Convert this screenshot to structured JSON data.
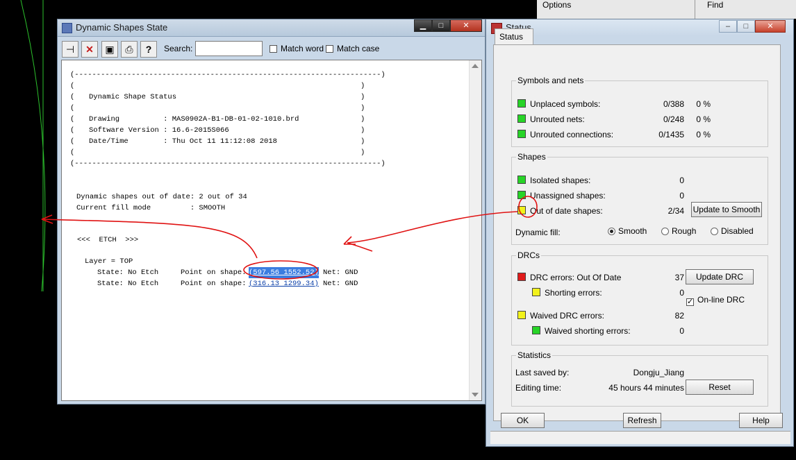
{
  "background": {
    "options_label": "Options",
    "find_label": "Find"
  },
  "dynamic_window": {
    "title": "Dynamic Shapes State",
    "search_label": "Search:",
    "search_value": "",
    "match_word": "Match word",
    "match_case": "Match case",
    "report": {
      "border": "(----------------------------------------------------------------------)",
      "paren_left": "(",
      "paren_right": ")",
      "heading": "Dynamic Shape Status",
      "drawing_line": "Drawing          : MAS0902A-B1-DB-01-02-1010.brd",
      "software_line": "Software Version : 16.6-2015S066",
      "date_line": "Date/Time        : Thu Oct 11 11:12:08 2018",
      "out_of_date_line": "Dynamic shapes out of date: 2 out of 34",
      "fill_mode_line": "Current fill mode         : SMOOTH",
      "etch_line": "<<<  ETCH  >>>",
      "layer_line": "Layer = TOP",
      "rows": [
        {
          "state": "State: No Etch",
          "point_label": "Point on shape:",
          "point": "(597.56 1552.52)",
          "net": "Net: GND"
        },
        {
          "state": "State: No Etch",
          "point_label": "Point on shape:",
          "point": "(316.13 1299.34)",
          "net": "Net: GND"
        }
      ]
    }
  },
  "status_window": {
    "title": "Status",
    "tab": "Status",
    "symbols": {
      "label": "Symbols and nets",
      "rows": [
        {
          "label": "Unplaced symbols:",
          "value": "0/388",
          "pct": "0 %",
          "color": "#27d427"
        },
        {
          "label": "Unrouted nets:",
          "value": "0/248",
          "pct": "0 %",
          "color": "#27d427"
        },
        {
          "label": "Unrouted connections:",
          "value": "0/1435",
          "pct": "0 %",
          "color": "#27d427"
        }
      ]
    },
    "shapes": {
      "label": "Shapes",
      "isolated": {
        "label": "Isolated shapes:",
        "value": "0"
      },
      "unassigned": {
        "label": "Unassigned shapes:",
        "value": "0"
      },
      "out_of_date": {
        "label": "Out of date shapes:",
        "value": "2/34"
      },
      "update_button": "Update to Smooth",
      "fill_label": "Dynamic fill:",
      "fill_options": [
        "Smooth",
        "Rough",
        "Disabled"
      ],
      "fill_selected": "Smooth"
    },
    "drcs": {
      "label": "DRCs",
      "errors": {
        "label": "DRC errors:  Out Of Date",
        "value": "37"
      },
      "shorting": {
        "label": "Shorting errors:",
        "value": "0"
      },
      "waived": {
        "label": "Waived DRC errors:",
        "value": "82"
      },
      "waived_shorting": {
        "label": "Waived shorting errors:",
        "value": "0"
      },
      "update_button": "Update DRC",
      "online_label": "On-line DRC",
      "online_checked": true
    },
    "statistics": {
      "label": "Statistics",
      "saved_label": "Last saved by:",
      "saved_value": "Dongju_Jiang",
      "editing_label": "Editing time:",
      "editing_value": "45 hours 44 minutes",
      "reset_button": "Reset"
    },
    "ok_button": "OK",
    "refresh_button": "Refresh",
    "help_button": "Help"
  }
}
